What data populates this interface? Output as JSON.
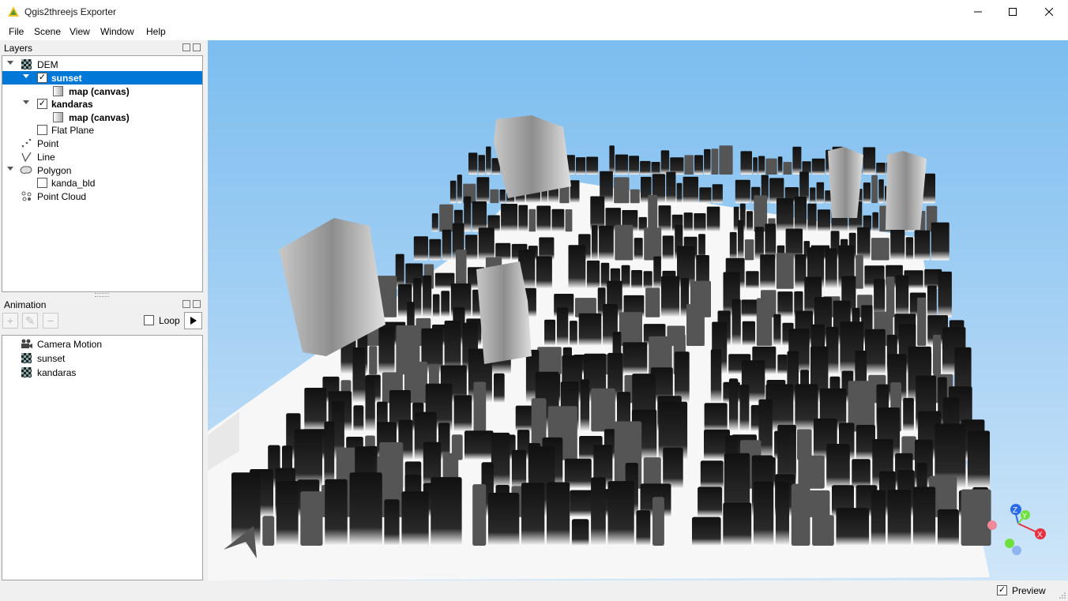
{
  "window": {
    "title": "Qgis2threejs Exporter"
  },
  "menu": [
    "File",
    "Scene",
    "View",
    "Window",
    "Help"
  ],
  "layers_panel": {
    "title": "Layers",
    "items": [
      {
        "label": "DEM",
        "bold": false
      },
      {
        "label": "sunset",
        "bold": true,
        "checked": true,
        "selected": true
      },
      {
        "label": "map (canvas)",
        "bold": true
      },
      {
        "label": "kandaras",
        "bold": true,
        "checked": true
      },
      {
        "label": "map (canvas)",
        "bold": true
      },
      {
        "label": "Flat Plane",
        "checked": false
      },
      {
        "label": "Point"
      },
      {
        "label": "Line"
      },
      {
        "label": "Polygon"
      },
      {
        "label": "kanda_bld",
        "checked": false
      },
      {
        "label": "Point Cloud"
      }
    ]
  },
  "animation_panel": {
    "title": "Animation",
    "loop_label": "Loop",
    "loop_checked": false,
    "items": [
      {
        "label": "Camera Motion"
      },
      {
        "label": "sunset"
      },
      {
        "label": "kandaras"
      }
    ]
  },
  "status": {
    "preview_label": "Preview",
    "preview_checked": true
  },
  "colors": {
    "selection": "#0078d7",
    "sky_top": "#7bbdef",
    "sky_bottom": "#cfe6f8"
  },
  "axes": {
    "x": "X",
    "y": "Y",
    "z": "Z"
  }
}
